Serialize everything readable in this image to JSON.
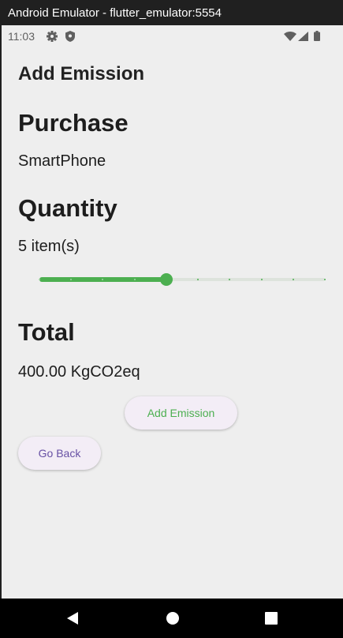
{
  "window": {
    "title": "Android Emulator - flutter_emulator:5554"
  },
  "status_bar": {
    "time": "11:03"
  },
  "app": {
    "title": "Add Emission"
  },
  "purchase": {
    "heading": "Purchase",
    "value": "SmartPhone"
  },
  "quantity": {
    "heading": "Quantity",
    "value_text": "5 item(s)",
    "slider": {
      "value": 5,
      "min": 1,
      "max": 10
    }
  },
  "total": {
    "heading": "Total",
    "value": "400.00 KgCO2eq"
  },
  "buttons": {
    "add_emission": "Add Emission",
    "go_back": "Go Back"
  },
  "colors": {
    "accent": "#4caf50",
    "primary_text": "#1d1d1d",
    "go_back_text": "#6750a4",
    "button_bg": "#f3edf6"
  }
}
